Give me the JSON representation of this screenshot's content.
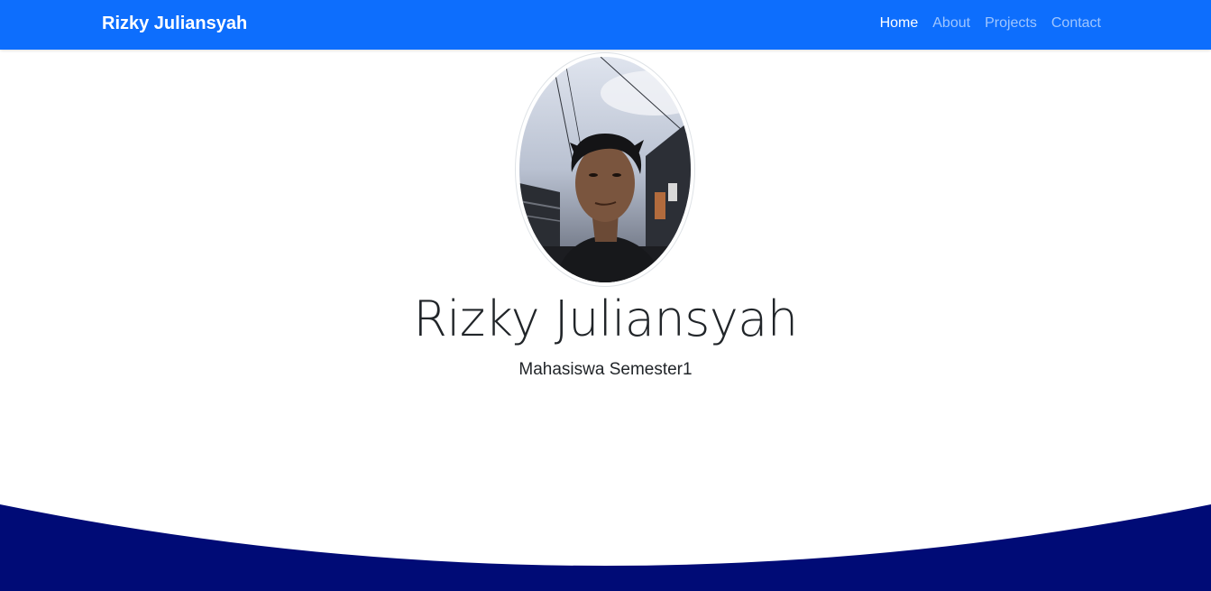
{
  "navbar": {
    "brand": "Rizky Juliansyah",
    "links": [
      {
        "label": "Home",
        "active": true
      },
      {
        "label": "About",
        "active": false
      },
      {
        "label": "Projects",
        "active": false
      },
      {
        "label": "Contact",
        "active": false
      }
    ]
  },
  "hero": {
    "name": "Rizky Juliansyah",
    "subtitle": "Mahasiswa Semester1"
  },
  "colors": {
    "navbar": "#0d6efd",
    "wave": "#000b76"
  }
}
